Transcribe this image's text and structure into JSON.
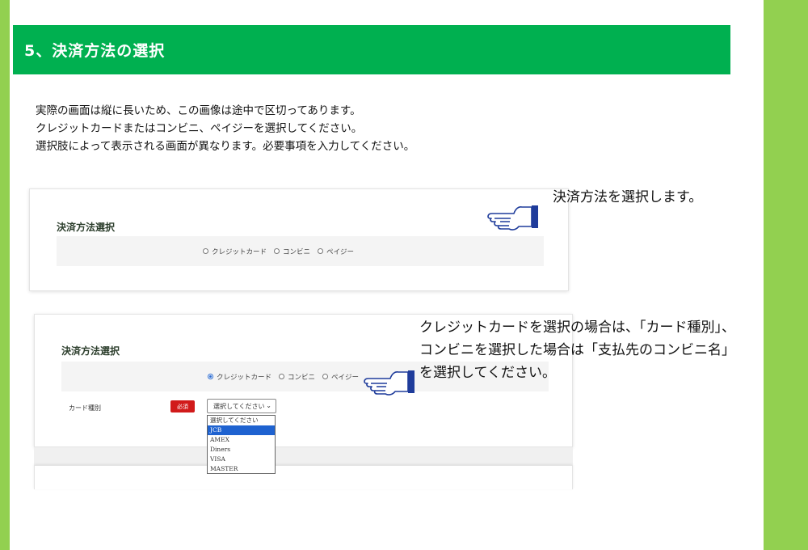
{
  "section": {
    "title": "5、決済方法の選択"
  },
  "intro": {
    "line1": "実際の画面は縦に長いため、この画像は途中で区切ってあります。",
    "line2": "クレジットカードまたはコンビニ、ペイジーを選択してください。",
    "line3": "選択肢によって表示される画面が異なります。必要事項を入力してください。"
  },
  "panel1": {
    "title": "決済方法選択",
    "options": [
      "クレジットカード",
      "コンビニ",
      "ペイジー"
    ]
  },
  "panel2": {
    "title": "決済方法選択",
    "options": [
      "クレジットカード",
      "コンビニ",
      "ペイジー"
    ],
    "selected_option": "クレジットカード",
    "field_label": "カード種別",
    "required_label": "必須",
    "select_value": "選択してください",
    "dropdown_options": [
      "選択してください",
      "JCB",
      "AMEX",
      "Diners",
      "VISA",
      "MASTER"
    ],
    "dropdown_highlighted": "JCB"
  },
  "callouts": {
    "c1": "決済方法を選択します。",
    "c2": "クレジットカードを選択の場合は、「カード種別」、コンビニを選択した場合は「支払先のコンビニ名」を選択してください。"
  },
  "icons": {
    "pointer": "pointing-hand-icon"
  },
  "colors": {
    "header_green": "#00b050",
    "side_green": "#92d050",
    "required_red": "#d11a1a",
    "highlight_blue": "#1e62d0"
  }
}
